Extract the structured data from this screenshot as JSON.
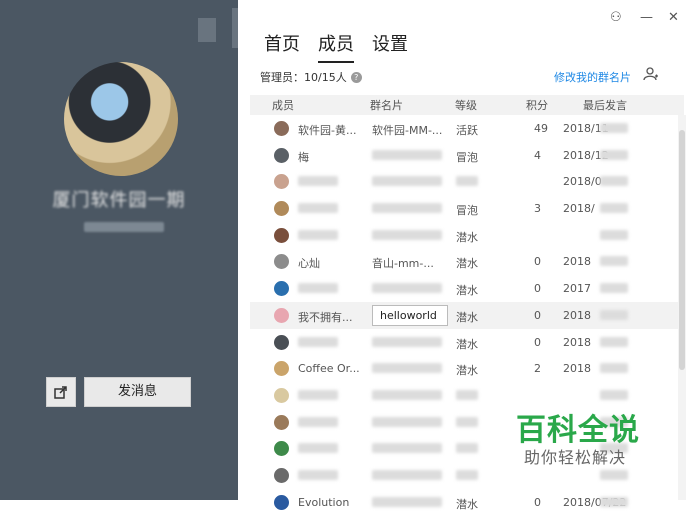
{
  "profile": {
    "group_name": "厦门软件园一期",
    "send_label": "发消息"
  },
  "tabs": [
    "首页",
    "成员",
    "设置"
  ],
  "window": {
    "pin": "⚇",
    "minimize": "—",
    "close": "✕"
  },
  "admin": {
    "label": "管理员：10/15人",
    "help": "?"
  },
  "edit_card_label": "修改我的群名片",
  "table": {
    "headers": [
      "成员",
      "群名片",
      "等级",
      "积分",
      "最后发言"
    ],
    "rows": [
      {
        "member": "软件园-黄...",
        "card": "软件园-MM-...",
        "level": "活跃",
        "points": "49",
        "last": "2018/11",
        "av": "#8a6b5a"
      },
      {
        "member": "梅",
        "card": "",
        "level": "冒泡",
        "points": "4",
        "last": "2018/12",
        "av": "#5a6066"
      },
      {
        "member": "",
        "card": "",
        "level": "",
        "points": "",
        "last": "2018/0",
        "av": "#c9a28f"
      },
      {
        "member": "",
        "card": "",
        "level": "冒泡",
        "points": "3",
        "last": "2018/",
        "av": "#b08a5a"
      },
      {
        "member": "",
        "card": "",
        "level": "潜水",
        "points": "",
        "last": "",
        "av": "#7a4f3c"
      },
      {
        "member": "心灿",
        "card": "音山-mm-...",
        "level": "潜水",
        "points": "0",
        "last": "2018",
        "av": "#8c8c8c"
      },
      {
        "member": "",
        "card": "",
        "level": "潜水",
        "points": "0",
        "last": "2017",
        "av": "#2a6fae"
      },
      {
        "member": "我不拥有...",
        "card": "helloworld",
        "level": "潜水",
        "points": "0",
        "last": "2018",
        "av": "#e8a6b0"
      },
      {
        "member": "",
        "card": "",
        "level": "潜水",
        "points": "0",
        "last": "2018",
        "av": "#4a4f55"
      },
      {
        "member": "Coffee Or...",
        "card": "",
        "level": "潜水",
        "points": "2",
        "last": "2018",
        "av": "#caa46a"
      },
      {
        "member": "",
        "card": "",
        "level": "",
        "points": "",
        "last": "",
        "av": "#d9c9a0"
      },
      {
        "member": "",
        "card": "",
        "level": "",
        "points": "",
        "last": "",
        "av": "#9a7a5a"
      },
      {
        "member": "",
        "card": "",
        "level": "",
        "points": "",
        "last": "",
        "av": "#3e8a4a"
      },
      {
        "member": "",
        "card": "",
        "level": "",
        "points": "",
        "last": "",
        "av": "#6a6a6a"
      },
      {
        "member": "Evolution",
        "card": "",
        "level": "潜水",
        "points": "0",
        "last": "2018/07/22",
        "av": "#2a5aa0"
      }
    ]
  },
  "watermark": {
    "title": "百科全说",
    "subtitle": "助你轻松解决"
  }
}
